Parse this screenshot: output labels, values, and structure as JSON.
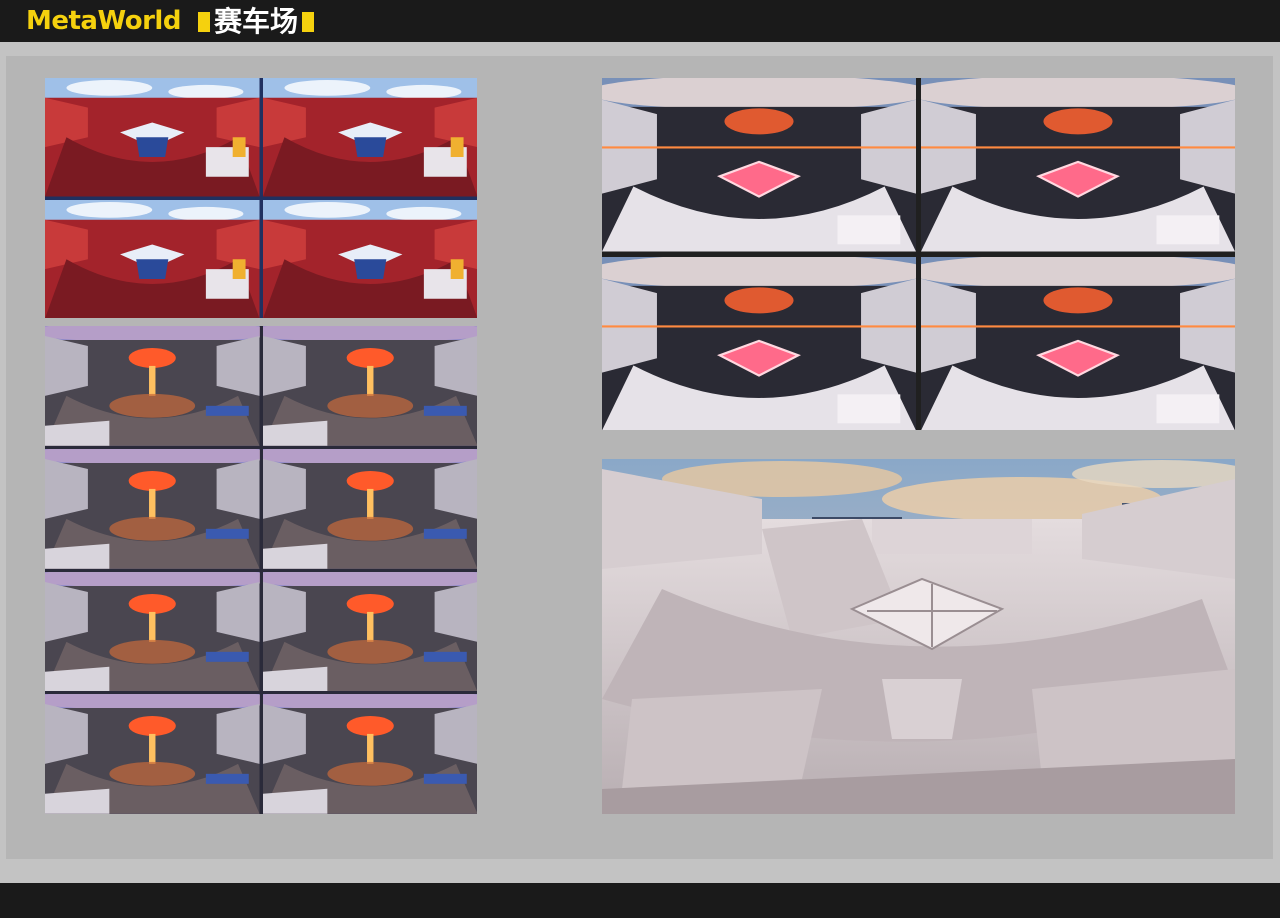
{
  "header": {
    "brand": "MetaWorld",
    "title": "赛车场",
    "accent_color": "#f5d10e"
  },
  "gallery": {
    "red_stadium_renders": [
      "render-1",
      "render-2",
      "render-3",
      "render-4"
    ],
    "night_stadium_renders": [
      "render-1",
      "render-2",
      "render-3",
      "render-4",
      "render-5",
      "render-6",
      "render-7",
      "render-8"
    ],
    "neon_stadium_renders": [
      "render-1",
      "render-2",
      "render-3",
      "render-4"
    ],
    "clay_model": "untextured-model"
  },
  "colors": {
    "background": "#1a1a1a",
    "band": "#c3c3c3",
    "panel": "#b5b5b5",
    "stadium_red": "#a3232b",
    "night_glow": "#ff5a2a",
    "neon_pink": "#ff6a8a",
    "clay": "#e8e2e4"
  }
}
